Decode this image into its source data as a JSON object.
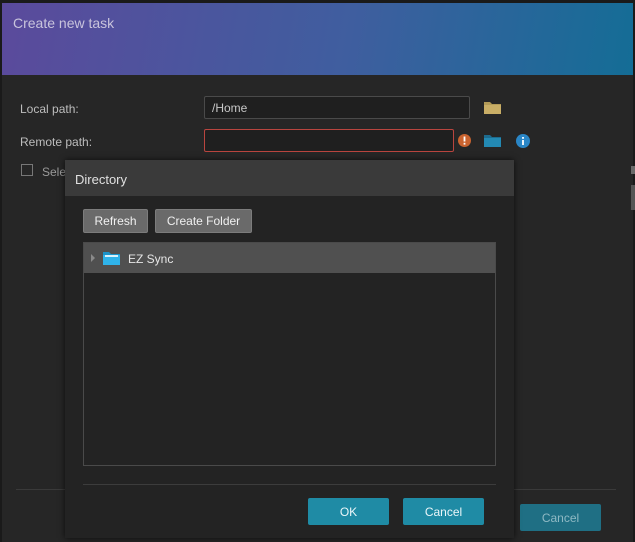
{
  "task_dialog": {
    "title": "Create new task",
    "local_path": {
      "label": "Local path:",
      "value": "/Home"
    },
    "remote_path": {
      "label": "Remote path:",
      "value": ""
    },
    "select_label": "Selec",
    "cancel_label": "Cancel"
  },
  "directory_dialog": {
    "title": "Directory",
    "refresh_label": "Refresh",
    "create_folder_label": "Create Folder",
    "tree": [
      {
        "label": "EZ Sync",
        "icon": "folder-icon"
      }
    ],
    "ok_label": "OK",
    "cancel_label": "Cancel"
  },
  "colors": {
    "accent": "#1f8ba5",
    "error": "#b9453f",
    "header_gradient_start": "#5b4a9c",
    "header_gradient_end": "#146d96"
  }
}
